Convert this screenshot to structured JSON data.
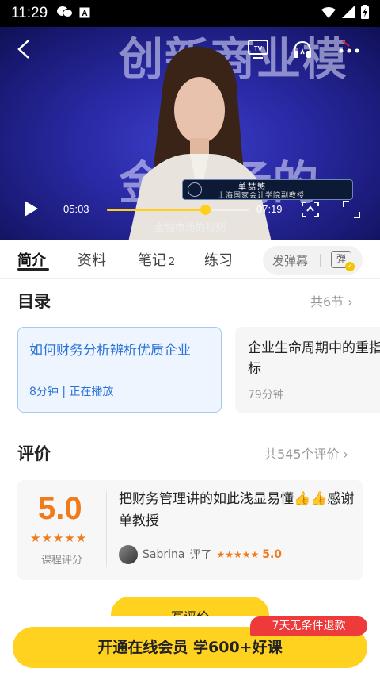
{
  "status_bar": {
    "time": "11:29",
    "icons": [
      "wechat-icon",
      "a-notification-icon",
      "wifi-icon",
      "signal-icon",
      "battery-icon"
    ]
  },
  "video": {
    "bg_title_top": "创新商业模",
    "bg_title_mid": "金 市场的",
    "nameplate_name": "单喆慜",
    "nameplate_title": "上海国家会计学院副教授",
    "caption": "金融市场的规则",
    "current_time": "05:03",
    "total_time": "07:19",
    "progress": 0.69,
    "icons": [
      "back-icon",
      "tv-cast-icon",
      "audio-icon",
      "more-icon",
      "play-icon",
      "screen-mirror-icon",
      "fullscreen-icon"
    ]
  },
  "tabs": {
    "items": [
      {
        "label": "简介",
        "active": true
      },
      {
        "label": "资料",
        "active": false
      },
      {
        "label": "笔记",
        "count": "2",
        "active": false
      },
      {
        "label": "练习",
        "active": false
      }
    ],
    "danmu_label": "发弹幕",
    "danmu_icon_label": "弹"
  },
  "catalog": {
    "title": "目录",
    "more": "共6节",
    "chapters": [
      {
        "title": "如何财务分析辨析优质企业",
        "meta": "8分钟 | 正在播放",
        "active": true
      },
      {
        "title": "企业生命周期中的重指标",
        "meta": "79分钟",
        "active": false
      }
    ]
  },
  "reviews": {
    "title": "评价",
    "more": "共545个评价",
    "score": "5.0",
    "score_label": "课程评分",
    "stars": "★★★★★",
    "text": "把财务管理讲的如此浅显易懂👍👍感谢单教授",
    "reviewer": "Sabrina",
    "reviewer_action": "评了",
    "reviewer_stars": "★★★★★",
    "reviewer_score": "5.0"
  },
  "write_review_label": "写评价",
  "cta": {
    "label": "开通在线会员 学600+好课",
    "badge": "7天无条件退款"
  },
  "colors": {
    "accent_yellow": "#ffd21f",
    "score_orange": "#f07b1a",
    "active_blue": "#2a73d8",
    "badge_red": "#ee3a3a"
  }
}
